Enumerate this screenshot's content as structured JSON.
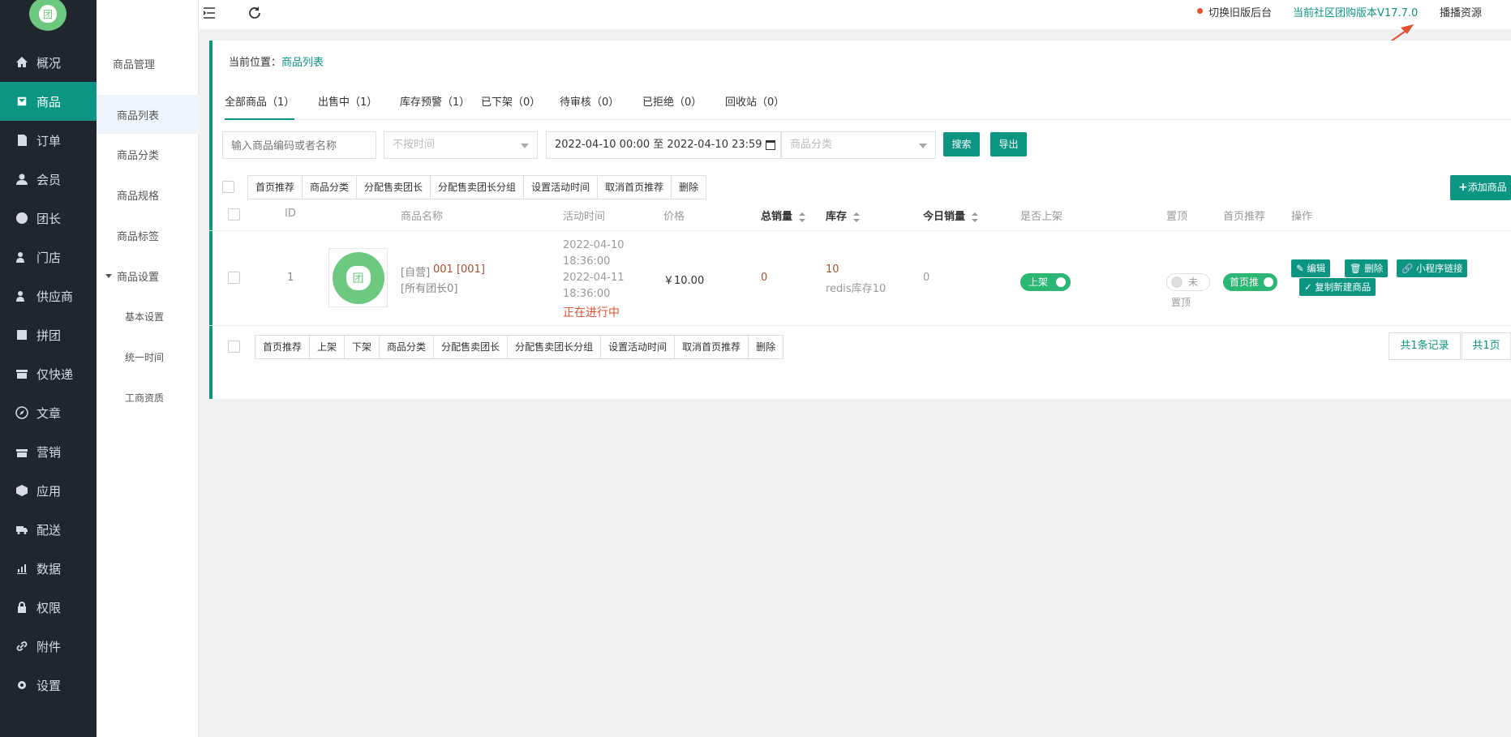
{
  "nav": [
    {
      "label": "概况",
      "icon": "home-icon"
    },
    {
      "label": "商品",
      "icon": "goods-icon"
    },
    {
      "label": "订单",
      "icon": "order-icon"
    },
    {
      "label": "会员",
      "icon": "member-icon"
    },
    {
      "label": "团长",
      "icon": "leader-icon"
    },
    {
      "label": "门店",
      "icon": "store-icon"
    },
    {
      "label": "供应商",
      "icon": "supplier-icon"
    },
    {
      "label": "拼团",
      "icon": "groupbuy-icon"
    },
    {
      "label": "仅快递",
      "icon": "express-icon"
    },
    {
      "label": "文章",
      "icon": "compass-icon"
    },
    {
      "label": "营销",
      "icon": "gift-icon"
    },
    {
      "label": "应用",
      "icon": "cube-icon"
    },
    {
      "label": "配送",
      "icon": "truck-icon"
    },
    {
      "label": "数据",
      "icon": "chart-icon"
    },
    {
      "label": "权限",
      "icon": "lock-icon"
    },
    {
      "label": "附件",
      "icon": "link-icon"
    },
    {
      "label": "设置",
      "icon": "gear-icon"
    }
  ],
  "subnav": {
    "title": "商品管理",
    "items": [
      "商品列表",
      "商品分类",
      "商品规格",
      "商品标签"
    ],
    "group": "商品设置",
    "group_items": [
      "基本设置",
      "统一时间",
      "工商资质"
    ]
  },
  "topbar": {
    "switch_old": "切换旧版后台",
    "version": "当前社区团购版本V17.7.0",
    "live": "播播资源"
  },
  "breadcrumb": {
    "prefix": "当前位置：",
    "current": "商品列表"
  },
  "tabs": [
    "全部商品（1）",
    "出售中（1）",
    "库存预警（1）",
    "已下架（0）",
    "待审核（0）",
    "已拒绝（0）",
    "回收站（0）"
  ],
  "filters": {
    "keyword_placeholder": "输入商品编码或者名称",
    "time_select": "不按时间",
    "date_range": "2022-04-10 00:00 至 2022-04-10 23:59",
    "category_placeholder": "商品分类",
    "search": "搜索",
    "export": "导出"
  },
  "top_actions": [
    "首页推荐",
    "商品分类",
    "分配售卖团长",
    "分配售卖团长分组",
    "设置活动时间",
    "取消首页推荐",
    "删除"
  ],
  "add_product": "添加商品",
  "columns": {
    "id": "ID",
    "name": "商品名称",
    "time": "活动时间",
    "price": "价格",
    "sales": "总销量",
    "stock": "库存",
    "today": "今日销量",
    "onsale": "是否上架",
    "top": "置顶",
    "recommend": "首页推荐",
    "ops": "操作"
  },
  "rows": [
    {
      "id": "1",
      "thumb_text": "团",
      "name_tag": "[自营]",
      "name": "001 [001]",
      "leaders": "[所有团长0]",
      "start_date": "2022-04-10",
      "start_time": "18:36:00",
      "end_date": "2022-04-11",
      "end_time": "18:36:00",
      "status": "正在进行中",
      "price": "￥10.00",
      "sales": "0",
      "stock": "10",
      "redis": "redis库存10",
      "today": "0",
      "onsale": "上架",
      "top_toggle": "未",
      "top_label": "置顶",
      "recommend": "首页推",
      "ops": {
        "edit": "编辑",
        "delete": "删除",
        "mini_link": "小程序链接",
        "copy": "复制新建商品"
      }
    }
  ],
  "bottom_actions": [
    "首页推荐",
    "上架",
    "下架",
    "商品分类",
    "分配售卖团长",
    "分配售卖团长分组",
    "设置活动时间",
    "取消首页推荐",
    "删除"
  ],
  "pager": {
    "total": "共1条记录",
    "pages": "共1页"
  },
  "colors": {
    "primary": "#0b9582",
    "sidebar": "#1f262d",
    "accent_red": "#e2502f"
  }
}
